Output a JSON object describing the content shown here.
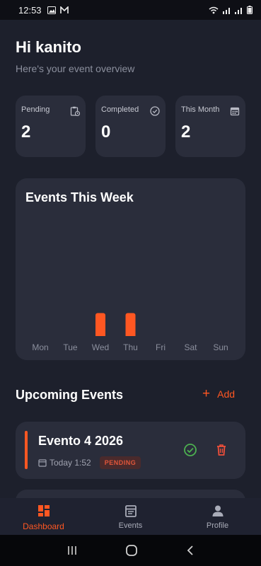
{
  "status": {
    "time": "12:53"
  },
  "header": {
    "greeting": "Hi kanito",
    "subtitle": "Here's your event overview"
  },
  "stats": [
    {
      "label": "Pending",
      "value": "2",
      "icon": "clipboard-clock-icon"
    },
    {
      "label": "Completed",
      "value": "0",
      "icon": "check-circle-icon"
    },
    {
      "label": "This Month",
      "value": "2",
      "icon": "calendar-icon"
    }
  ],
  "chart": {
    "title": "Events This Week"
  },
  "chart_data": {
    "type": "bar",
    "title": "Events This Week",
    "categories": [
      "Mon",
      "Tue",
      "Wed",
      "Thu",
      "Fri",
      "Sat",
      "Sun"
    ],
    "values": [
      0,
      0,
      1,
      1,
      0,
      0,
      0
    ],
    "ylim": [
      0,
      4
    ],
    "grid": false,
    "color": "#ff5722"
  },
  "upcoming": {
    "title": "Upcoming Events",
    "add_label": "Add",
    "events": [
      {
        "title": "Evento 4 2026",
        "time": "Today 1:52",
        "status": "PENDING"
      }
    ]
  },
  "nav": {
    "items": [
      {
        "label": "Dashboard",
        "icon": "dashboard-icon",
        "active": true
      },
      {
        "label": "Events",
        "icon": "events-icon",
        "active": false
      },
      {
        "label": "Profile",
        "icon": "profile-icon",
        "active": false
      }
    ]
  },
  "colors": {
    "accent": "#ff5722",
    "background": "#1d202c",
    "card": "#2a2d3b",
    "success": "#4caf50"
  }
}
